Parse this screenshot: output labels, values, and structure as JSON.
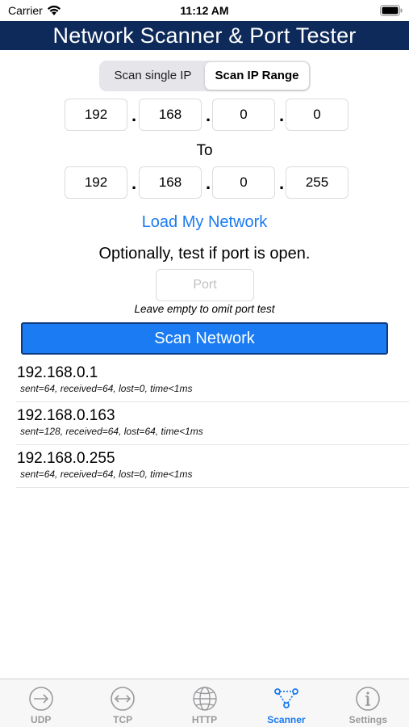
{
  "status_bar": {
    "carrier": "Carrier",
    "time": "11:12 AM"
  },
  "title": "Network Scanner & Port Tester",
  "segmented": {
    "options": [
      "Scan single IP",
      "Scan IP Range"
    ],
    "selected": "Scan IP Range"
  },
  "range_start": {
    "octets": [
      "192",
      "168",
      "0",
      "0"
    ]
  },
  "to_label": "To",
  "range_end": {
    "octets": [
      "192",
      "168",
      "0",
      "255"
    ]
  },
  "dot": ".",
  "load_network_label": "Load My Network",
  "port_hint": "Optionally, test if port is open.",
  "port_field": {
    "placeholder": "Port",
    "value": ""
  },
  "omit_note": "Leave empty to omit port test",
  "scan_button_label": "Scan Network",
  "results": [
    {
      "ip": "192.168.0.1",
      "detail": "sent=64, received=64, lost=0, time<1ms"
    },
    {
      "ip": "192.168.0.163",
      "detail": "sent=128, received=64, lost=64, time<1ms"
    },
    {
      "ip": "192.168.0.255",
      "detail": "sent=64, received=64, lost=0, time<1ms"
    }
  ],
  "tabs": [
    {
      "label": "UDP",
      "icon": "arrow-right-circle-icon",
      "active": false
    },
    {
      "label": "TCP",
      "icon": "arrow-left-right-circle-icon",
      "active": false
    },
    {
      "label": "HTTP",
      "icon": "globe-icon",
      "active": false
    },
    {
      "label": "Scanner",
      "icon": "network-nodes-icon",
      "active": true
    },
    {
      "label": "Settings",
      "icon": "info-circle-icon",
      "active": false
    }
  ],
  "colors": {
    "title_bar": "#0e2a5a",
    "accent": "#1a7bf2",
    "tab_inactive": "#9a9a9e"
  }
}
